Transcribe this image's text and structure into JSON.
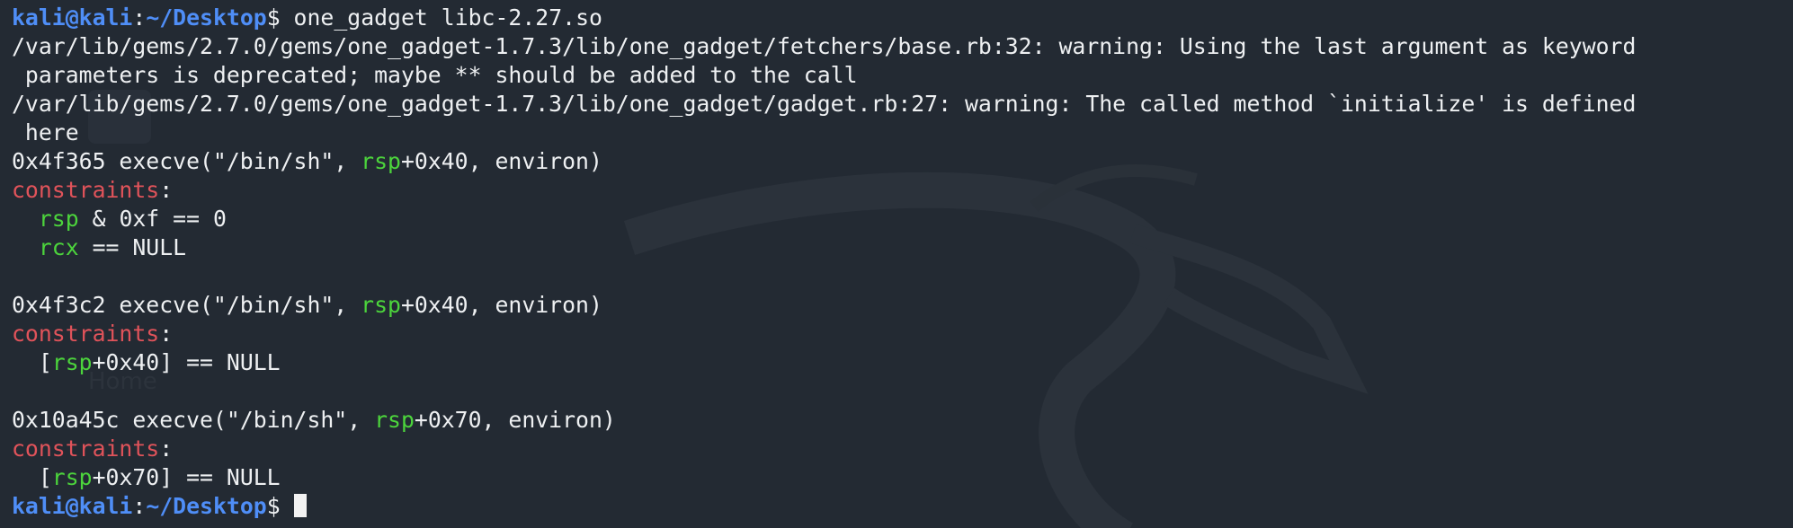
{
  "prompt1": {
    "user_host": "kali@kali",
    "sep": ":",
    "path": "~/Desktop",
    "symbol": "$",
    "command": " one_gadget libc-2.27.so"
  },
  "warnings": [
    "/var/lib/gems/2.7.0/gems/one_gadget-1.7.3/lib/one_gadget/fetchers/base.rb:32: warning: Using the last argument as keyword",
    " parameters is deprecated; maybe ** should be added to the call",
    "/var/lib/gems/2.7.0/gems/one_gadget-1.7.3/lib/one_gadget/gadget.rb:27: warning: The called method `initialize' is defined",
    " here"
  ],
  "gadgets": [
    {
      "addr_call": "0x4f365 execve(\"/bin/sh\", ",
      "reg": "rsp",
      "call_tail": "+0x40, environ)",
      "constraints_label": "constraints",
      "constraints_colon": ":",
      "c1_reg": "rsp",
      "c1_rest": " & 0xf == 0",
      "c2_reg": "rcx",
      "c2_rest": " == NULL"
    },
    {
      "addr_call": "0x4f3c2 execve(\"/bin/sh\", ",
      "reg": "rsp",
      "call_tail": "+0x40, environ)",
      "constraints_label": "constraints",
      "constraints_colon": ":",
      "c1_open": "[",
      "c1_reg": "rsp",
      "c1_rest": "+0x40] == NULL"
    },
    {
      "addr_call": "0x10a45c execve(\"/bin/sh\", ",
      "reg": "rsp",
      "call_tail": "+0x70, environ)",
      "constraints_label": "constraints",
      "constraints_colon": ":",
      "c1_open": "[",
      "c1_reg": "rsp",
      "c1_rest": "+0x70] == NULL"
    }
  ],
  "prompt2": {
    "user_host": "kali@kali",
    "sep": ":",
    "path": "~/Desktop",
    "symbol": "$",
    "trailing": " "
  },
  "wallpaper": {
    "home_label": "Home"
  },
  "colors": {
    "background": "#232a33",
    "prompt": "#4f8ef7",
    "constraints": "#e0535a",
    "register": "#4cd43c",
    "text": "#eef0f2"
  }
}
